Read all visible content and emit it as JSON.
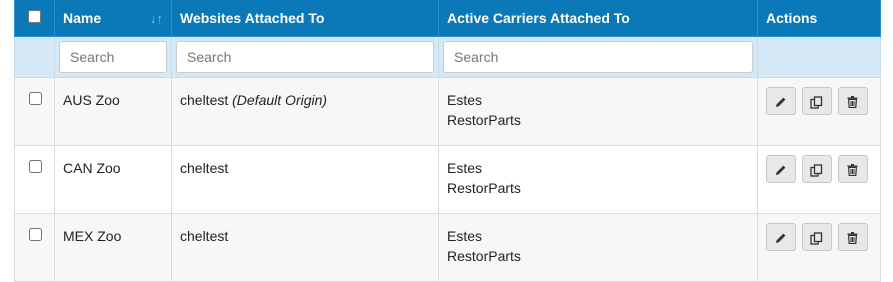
{
  "columns": {
    "name": "Name",
    "websites": "Websites Attached To",
    "carriers": "Active Carriers Attached To",
    "actions": "Actions"
  },
  "filters": {
    "name_placeholder": "Search",
    "websites_placeholder": "Search",
    "carriers_placeholder": "Search"
  },
  "rows": [
    {
      "name": "AUS Zoo",
      "website": "cheltest",
      "website_note": "(Default Origin)",
      "carriers": [
        "Estes",
        "RestorParts"
      ]
    },
    {
      "name": "CAN Zoo",
      "website": "cheltest",
      "website_note": "",
      "carriers": [
        "Estes",
        "RestorParts"
      ]
    },
    {
      "name": "MEX Zoo",
      "website": "cheltest",
      "website_note": "",
      "carriers": [
        "Estes",
        "RestorParts"
      ]
    }
  ],
  "icons": {
    "sort": "sort-icon",
    "edit": "pencil-icon",
    "copy": "copy-icon",
    "delete": "trash-icon"
  },
  "colors": {
    "header_bg": "#0b78b8",
    "filter_bg": "#d5e8f5",
    "row_alt_bg": "#f7f7f7"
  }
}
